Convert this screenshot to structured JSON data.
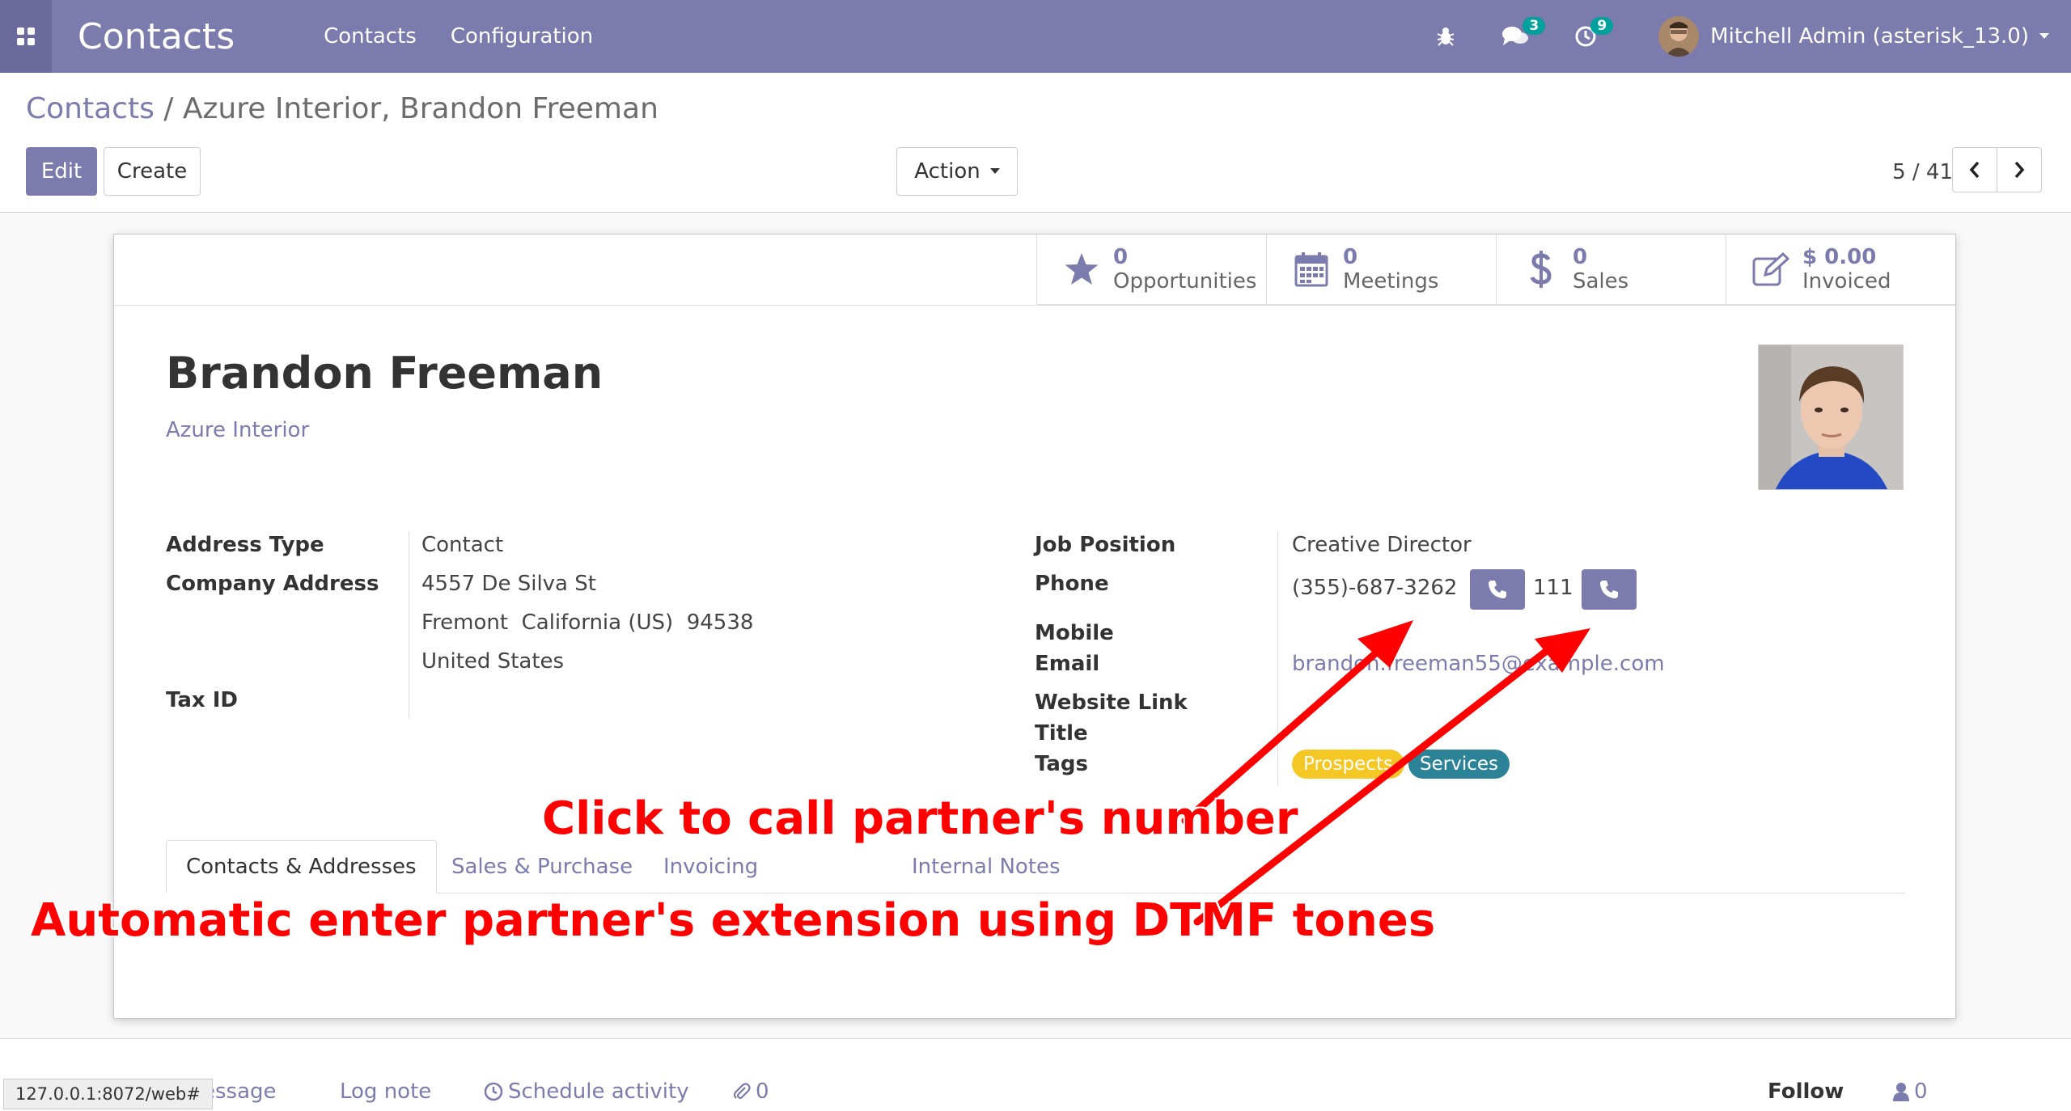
{
  "navbar": {
    "brand": "Contacts",
    "menu": [
      "Contacts",
      "Configuration"
    ],
    "messages_count": "3",
    "activities_count": "9",
    "user": "Mitchell Admin (asterisk_13.0)"
  },
  "breadcrumb": {
    "root": "Contacts",
    "separator": "/",
    "current": "Azure Interior, Brandon Freeman"
  },
  "buttons": {
    "edit": "Edit",
    "create": "Create",
    "action": "Action"
  },
  "pager": {
    "value": "5 / 41"
  },
  "stats": [
    {
      "value": "0",
      "label": "Opportunities",
      "icon": "star-icon"
    },
    {
      "value": "0",
      "label": "Meetings",
      "icon": "calendar-icon"
    },
    {
      "value": "0",
      "label": "Sales",
      "icon": "dollar-icon"
    },
    {
      "value": "$ 0.00",
      "label": "Invoiced",
      "icon": "edit-icon"
    }
  ],
  "partner": {
    "name": "Brandon Freeman",
    "company": "Azure Interior"
  },
  "fields_left": {
    "address_type_label": "Address Type",
    "address_type": "Contact",
    "company_address_label": "Company Address",
    "street": "4557 De Silva St",
    "city_line": "Fremont  California (US)  94538",
    "country": "United States",
    "tax_id_label": "Tax ID"
  },
  "fields_right": {
    "job_position_label": "Job Position",
    "job_position": "Creative Director",
    "phone_label": "Phone",
    "phone": "(355)-687-3262",
    "extension": "111",
    "mobile_label": "Mobile",
    "email_label": "Email",
    "email": "brandon.freeman55@example.com",
    "website_label": "Website Link",
    "title_label": "Title",
    "tags_label": "Tags",
    "tags": [
      {
        "label": "Prospects",
        "color": "#f4c724"
      },
      {
        "label": "Services",
        "color": "#2c8397"
      }
    ]
  },
  "tabs": [
    "Contacts & Addresses",
    "Sales & Purchase",
    "Invoicing",
    "Internal Notes"
  ],
  "annotations": {
    "call": "Click to call partner's number",
    "dtmf": "Automatic enter partner's extension using DTMF tones"
  },
  "chatter": {
    "send_message": "essage",
    "log_note": "Log note",
    "schedule_activity": "Schedule activity",
    "attachments": "0",
    "follow": "Follow",
    "followers": "0"
  },
  "status_url": "127.0.0.1:8072/web#",
  "colors": {
    "primary": "#7c7bad",
    "annotation": "#ff0000",
    "badge": "#00a09d"
  }
}
